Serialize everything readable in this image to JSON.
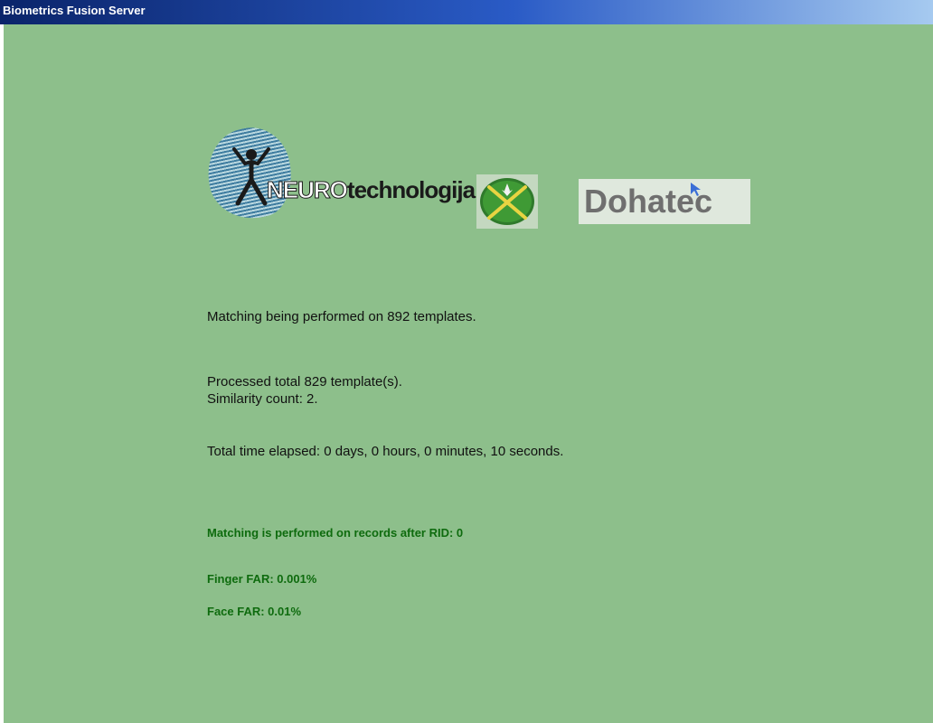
{
  "window": {
    "title": "Biometrics Fusion Server"
  },
  "logos": {
    "neuro_part": "NEURO",
    "tech_part": "technologija",
    "dohatec": "Dohatec"
  },
  "status": {
    "matching_templates": "Matching being performed on 892 templates.",
    "processed_total": "Processed total 829 template(s).",
    "similarity_count": "Similarity count: 2.",
    "time_elapsed": "Total time elapsed: 0 days, 0 hours, 0 minutes, 10 seconds."
  },
  "settings": {
    "rid_info": "Matching is performed on records after RID: 0",
    "finger_far": "Finger FAR: 0.001%",
    "face_far": "Face FAR: 0.01%"
  },
  "colors": {
    "background": "#8dbf8b",
    "settings_text": "#0e6b0e",
    "titlebar_start": "#0a246a",
    "titlebar_end": "#a6caf0"
  },
  "icons": {
    "neuro_logo": "neurotechnologija-logo",
    "emblem": "crossed-swords-emblem",
    "dohatec_logo": "dohatec-logo"
  }
}
